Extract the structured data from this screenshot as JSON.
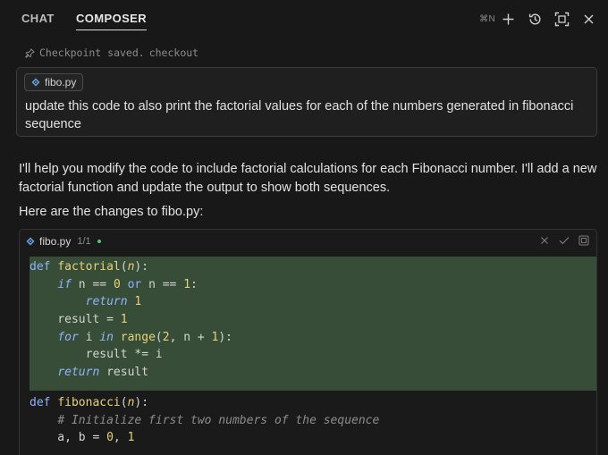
{
  "header": {
    "tabs": [
      {
        "label": "CHAT",
        "active": false
      },
      {
        "label": "COMPOSER",
        "active": true
      }
    ],
    "new_shortcut": "⌘N",
    "icons": [
      "plus-icon",
      "history-icon",
      "expand-icon",
      "close-icon"
    ]
  },
  "checkpoint": {
    "text": "Checkpoint saved.",
    "link": "checkout"
  },
  "user_message": {
    "file_chip": "fibo.py",
    "text": "update this code to also print the factorial values for each of the numbers generated in fibonacci sequence"
  },
  "assistant": {
    "paragraph1": "I'll help you modify the code to include factorial calculations for each Fibonacci number. I'll add a new factorial function and update the output to show both sequences.",
    "paragraph2": "Here are the changes to fibo.py:"
  },
  "code_block": {
    "filename": "fibo.py",
    "count": "1/1",
    "colors": {
      "added_bg": "#374d37",
      "keyword": "#8fb3ff",
      "function": "#e6d27a",
      "comment": "#8d8d8d",
      "status_dot": "#4ec97a"
    },
    "added_lines": [
      "def factorial(n):",
      "    if n == 0 or n == 1:",
      "        return 1",
      "    result = 1",
      "    for i in range(2, n + 1):",
      "        result *= i",
      "    return result"
    ],
    "lines": [
      "def fibonacci(n):",
      "    # Initialize first two numbers of the sequence",
      "    a, b = 0, 1"
    ]
  }
}
